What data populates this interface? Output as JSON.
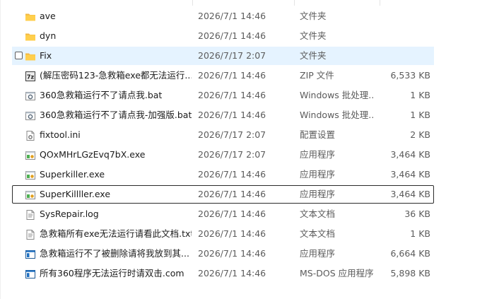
{
  "files": [
    {
      "name": "ave",
      "date": "2026/7/1 14:46",
      "type": "文件夹",
      "size": "",
      "icon": "folder-icon"
    },
    {
      "name": "dyn",
      "date": "2026/7/1 14:46",
      "type": "文件夹",
      "size": "",
      "icon": "folder-icon"
    },
    {
      "name": "Fix",
      "date": "2026/7/17 2:07",
      "type": "文件夹",
      "size": "",
      "icon": "folder-icon"
    },
    {
      "name": "(解压密码123-急救箱exe都无法运行...",
      "date": "2026/7/1 14:46",
      "type": "ZIP 文件",
      "size": "6,533 KB",
      "icon": "zip-archive-icon"
    },
    {
      "name": "360急救箱运行不了请点我.bat",
      "date": "2026/7/1 14:46",
      "type": "Windows 批处理...",
      "size": "1 KB",
      "icon": "batch-file-icon"
    },
    {
      "name": "360急救箱运行不了请点我-加强版.bat",
      "date": "2026/7/1 14:46",
      "type": "Windows 批处理...",
      "size": "1 KB",
      "icon": "batch-file-icon"
    },
    {
      "name": "fixtool.ini",
      "date": "2026/7/17 2:07",
      "type": "配置设置",
      "size": "2 KB",
      "icon": "settings-file-icon"
    },
    {
      "name": "QOxMHrLGzEvq7bX.exe",
      "date": "2026/7/17 2:07",
      "type": "应用程序",
      "size": "3,464 KB",
      "icon": "executable-icon"
    },
    {
      "name": "Superkiller.exe",
      "date": "2026/7/1 14:46",
      "type": "应用程序",
      "size": "3,464 KB",
      "icon": "executable-icon"
    },
    {
      "name": "SuperKillller.exe",
      "date": "2026/7/1 14:46",
      "type": "应用程序",
      "size": "3,464 KB",
      "icon": "executable-icon"
    },
    {
      "name": "SysRepair.log",
      "date": "2026/7/1 14:46",
      "type": "文本文档",
      "size": "36 KB",
      "icon": "text-file-icon"
    },
    {
      "name": "急救箱所有exe无法运行请看此文档.txt",
      "date": "2026/7/1 14:46",
      "type": "文本文档",
      "size": "1 KB",
      "icon": "text-file-icon"
    },
    {
      "name": "急救箱运行不了被删除请将我放到其...",
      "date": "2026/7/1 14:46",
      "type": "应用程序",
      "size": "6,664 KB",
      "icon": "app-window-icon"
    },
    {
      "name": "所有360程序无法运行时请双击.com",
      "date": "2026/7/1 14:46",
      "type": "MS-DOS 应用程序",
      "size": "5,898 KB",
      "icon": "app-window-icon"
    }
  ],
  "hover_index": 2,
  "focused_index": 9
}
